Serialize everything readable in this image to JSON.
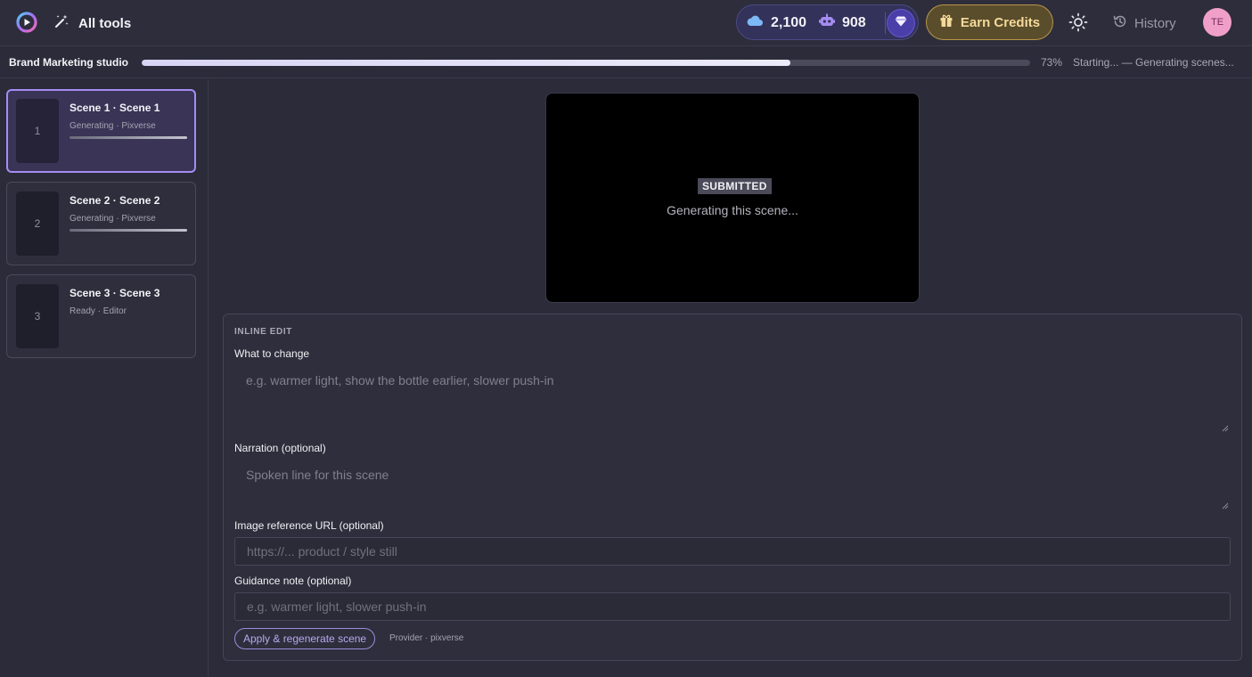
{
  "topbar": {
    "all_tools_label": "All tools",
    "credits_cloud": "2,100",
    "credits_bot": "908",
    "earn_credits_label": "Earn Credits",
    "history_label": "History",
    "avatar_initials": "TE"
  },
  "progress": {
    "studio_title": "Brand Marketing studio",
    "percent_value": 73,
    "percent_label": "73%",
    "status_text": "Starting... — Generating scenes..."
  },
  "scenes": [
    {
      "number": "1",
      "title": "Scene 1 · Scene 1",
      "subtitle": "Generating · Pixverse",
      "active": true,
      "progress": 1.0
    },
    {
      "number": "2",
      "title": "Scene 2 · Scene 2",
      "subtitle": "Generating · Pixverse",
      "active": false,
      "progress": 1.0
    },
    {
      "number": "3",
      "title": "Scene 3 · Scene 3",
      "subtitle": "Ready · Editor",
      "active": false
    }
  ],
  "preview": {
    "badge": "SUBMITTED",
    "message": "Generating this scene..."
  },
  "edit": {
    "section_label": "INLINE EDIT",
    "change_label": "What to change",
    "change_placeholder": "e.g. warmer light, show the bottle earlier, slower push-in",
    "narration_label": "Narration (optional)",
    "narration_placeholder": "Spoken line for this scene",
    "image_label": "Image reference URL (optional)",
    "image_placeholder": "https://... product / style still",
    "guidance_label": "Guidance note (optional)",
    "guidance_placeholder": "e.g. warmer light, slower push-in",
    "apply_label": "Apply & regenerate scene",
    "provider_note": "Provider · pixverse"
  },
  "colors": {
    "accent": "#a58cf4",
    "earn_gold": "#f4d99a",
    "avatar_pink": "#f0a0c8"
  }
}
